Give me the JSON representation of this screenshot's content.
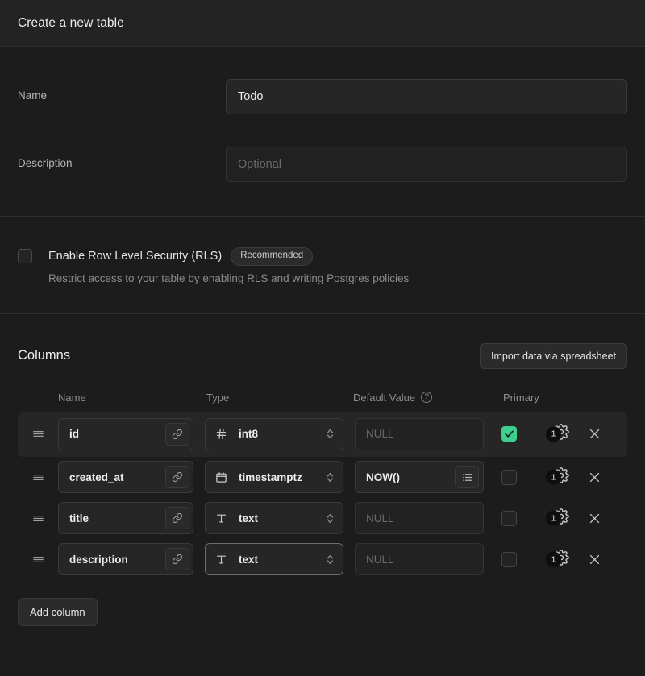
{
  "header": {
    "title": "Create a new table"
  },
  "form": {
    "name": {
      "label": "Name",
      "value": "Todo",
      "placeholder": ""
    },
    "description": {
      "label": "Description",
      "value": "",
      "placeholder": "Optional"
    }
  },
  "rls": {
    "title": "Enable Row Level Security (RLS)",
    "badge": "Recommended",
    "description": "Restrict access to your table by enabling RLS and writing Postgres policies",
    "checked": false
  },
  "columns_section": {
    "title": "Columns",
    "import_button": "Import data via spreadsheet",
    "headers": {
      "name": "Name",
      "type": "Type",
      "default_value": "Default Value",
      "default_value_help": "?",
      "primary": "Primary"
    },
    "add_column_button": "Add column",
    "rows": [
      {
        "name": "id",
        "type": "int8",
        "type_icon": "hash-icon",
        "default_value": "",
        "default_placeholder": "NULL",
        "primary": true,
        "settings_count": "1",
        "selected": true,
        "type_focused": false,
        "has_default_list_button": false
      },
      {
        "name": "created_at",
        "type": "timestamptz",
        "type_icon": "calendar-icon",
        "default_value": "NOW()",
        "default_placeholder": "NULL",
        "primary": false,
        "settings_count": "1",
        "selected": false,
        "type_focused": false,
        "has_default_list_button": true
      },
      {
        "name": "title",
        "type": "text",
        "type_icon": "text-icon",
        "default_value": "",
        "default_placeholder": "NULL",
        "primary": false,
        "settings_count": "1",
        "selected": false,
        "type_focused": false,
        "has_default_list_button": false
      },
      {
        "name": "description",
        "type": "text",
        "type_icon": "text-icon",
        "default_value": "",
        "default_placeholder": "NULL",
        "primary": false,
        "settings_count": "1",
        "selected": false,
        "type_focused": true,
        "has_default_list_button": false
      }
    ]
  },
  "colors": {
    "accent_green": "#3ecf8e",
    "panel_bg": "#1c1c1c",
    "header_bg": "#232323",
    "row_selected_bg": "#262626"
  }
}
